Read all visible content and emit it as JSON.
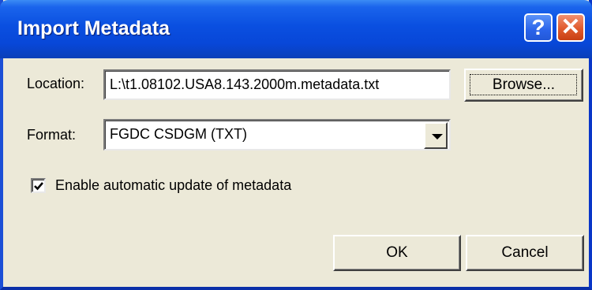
{
  "window": {
    "title": "Import Metadata",
    "help_glyph": "?",
    "close_glyph": "✕"
  },
  "form": {
    "location_label": "Location:",
    "location_value": "L:\\t1.08102.USA8.143.2000m.metadata.txt",
    "browse_label": "Browse...",
    "format_label": "Format:",
    "format_value": "FGDC CSDGM (TXT)",
    "auto_update_label": "Enable automatic update of metadata",
    "auto_update_checked": true
  },
  "actions": {
    "ok_label": "OK",
    "cancel_label": "Cancel"
  },
  "icons": [
    "help-icon",
    "close-icon",
    "dropdown-arrow-icon",
    "checkmark-icon"
  ],
  "colors": {
    "titlebar": "#0a4fe0",
    "dialog_bg": "#ece9d8",
    "close_button": "#e05a2c"
  }
}
